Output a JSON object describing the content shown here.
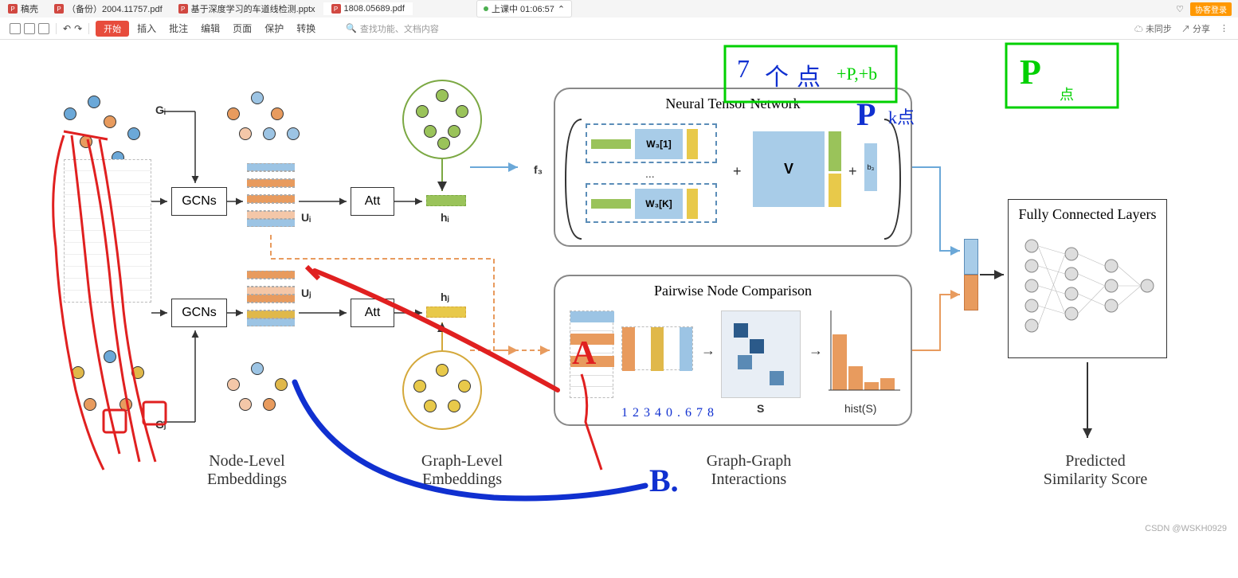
{
  "tabs": [
    {
      "label": "稿壳"
    },
    {
      "label": "（备份）2004.11757.pdf"
    },
    {
      "label": "基于深度学习的车道线检测.pptx"
    },
    {
      "label": "1808.05689.pdf"
    }
  ],
  "class_time": "上课中 01:06:57",
  "top_right": {
    "heart": "♡",
    "login": "协客登录"
  },
  "toolbar": {
    "start": "开始",
    "items": [
      "插入",
      "批注",
      "编辑",
      "页面",
      "保护",
      "转换"
    ],
    "search_placeholder": "查找功能、文档内容",
    "sync": "未同步",
    "share": "分享"
  },
  "diagram": {
    "g_i": "Gᵢ",
    "g_j": "Gⱼ",
    "gcns": "GCNs",
    "att": "Att",
    "u_i": "Uᵢ",
    "u_j": "Uⱼ",
    "h_i": "hᵢ",
    "h_j": "hⱼ",
    "f3": "f₃",
    "w3_1": "W₃[1]",
    "w3_k": "W₃[K]",
    "dots": "...",
    "plus": "+",
    "V": "V",
    "b3": "b₃",
    "S": "S",
    "histS": "hist(S)",
    "ntn": "Neural Tensor Network",
    "pnc": "Pairwise Node Comparison",
    "fcl": "Fully Connected Layers",
    "col1": "Node-Level\nEmbeddings",
    "col2": "Graph-Level\nEmbeddings",
    "col3": "Graph-Graph\nInteractions",
    "col4": "Predicted\nSimilarity Score"
  },
  "annotations": {
    "numbers": "1 2 3 4 0 . 6 7 8",
    "A": "A",
    "B": "B.",
    "seven": "7",
    "ge": "个",
    "dian": "点",
    "tp": "+P,+b",
    "p_big": "P",
    "k_dian": "k点"
  },
  "watermark": "CSDN @WSKH0929"
}
